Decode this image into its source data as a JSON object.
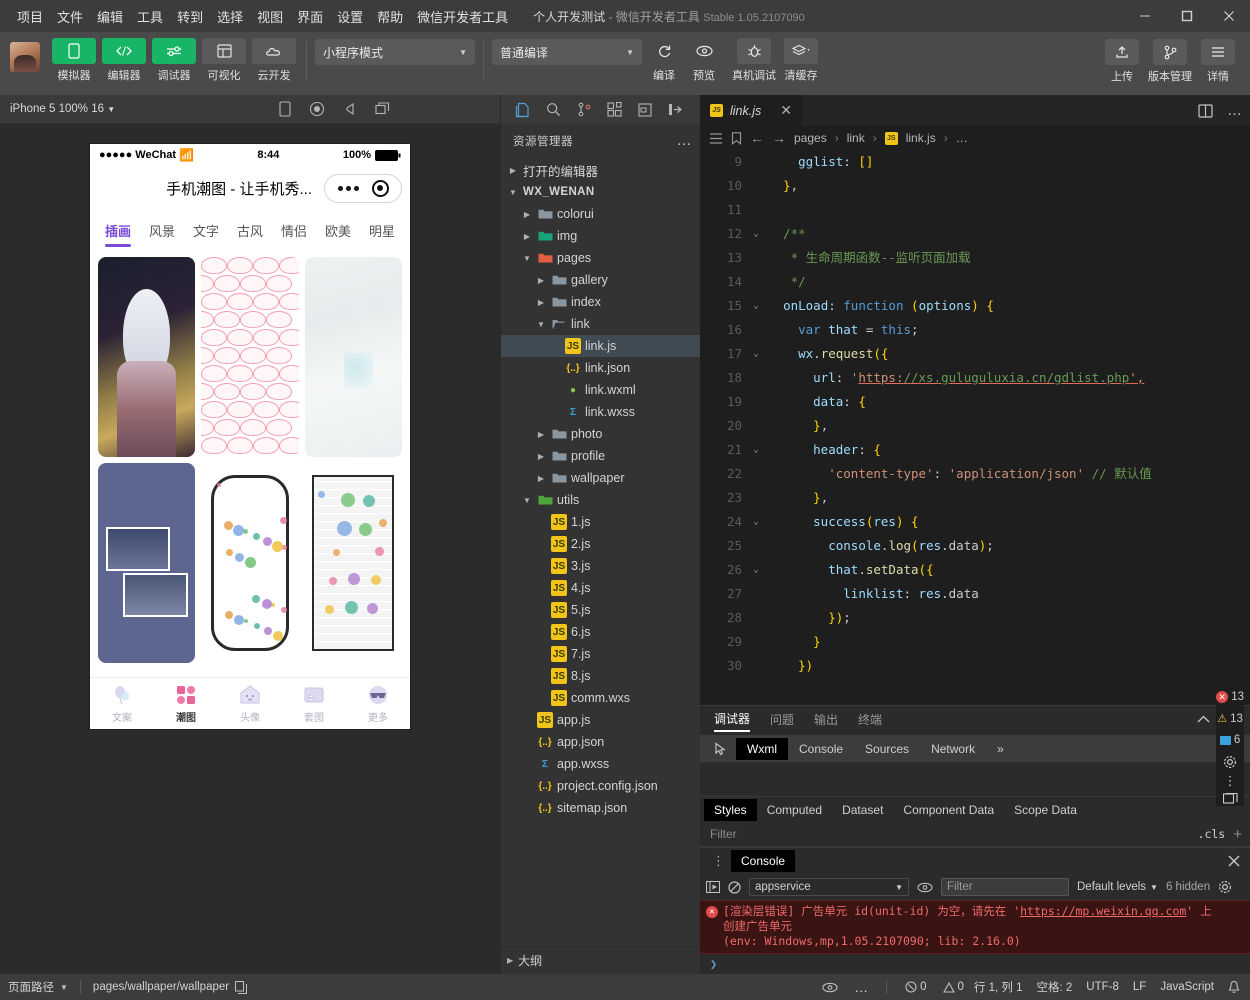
{
  "menu": {
    "items": [
      "项目",
      "文件",
      "编辑",
      "工具",
      "转到",
      "选择",
      "视图",
      "界面",
      "设置",
      "帮助",
      "微信开发者工具"
    ],
    "project_name": "个人开发测试",
    "dash": "-",
    "app_name": "微信开发者工具",
    "version": "Stable 1.05.2107090",
    "window": {
      "minimize": "–",
      "maximize": "▢",
      "close": "✕"
    }
  },
  "toolbar": {
    "buttons": [
      {
        "label": "模拟器",
        "icon": "phone-icon",
        "style": "green"
      },
      {
        "label": "编辑器",
        "icon": "code-icon",
        "style": "green"
      },
      {
        "label": "调试器",
        "icon": "sliders-icon",
        "style": "green"
      },
      {
        "label": "可视化",
        "icon": "layout-icon",
        "style": "grey"
      },
      {
        "label": "云开发",
        "icon": "cloud-icon",
        "style": "grey"
      }
    ],
    "mode_select": "小程序模式",
    "compile_select": "普通编译",
    "actions": [
      {
        "label": "编译",
        "icon": "refresh-icon"
      },
      {
        "label": "预览",
        "icon": "eye-icon"
      },
      {
        "label": "真机调试",
        "icon": "bug-icon"
      },
      {
        "label": "清缓存",
        "icon": "layers-icon"
      }
    ],
    "right_actions": [
      {
        "label": "上传",
        "icon": "upload-icon"
      },
      {
        "label": "版本管理",
        "icon": "branch-icon"
      },
      {
        "label": "详情",
        "icon": "menu-icon"
      }
    ]
  },
  "simulator": {
    "device": "iPhone 5 100% 16",
    "toolbar_icons": [
      "phone-rotate-icon",
      "record-icon",
      "volume-icon",
      "window-icon"
    ],
    "phone": {
      "carrier": "●●●●● WeChat",
      "wifi": "●",
      "time": "8:44",
      "battery_pct": "100%",
      "nav_title": "手机潮图 - 让手机秀...",
      "tabs": [
        "插画",
        "风景",
        "文字",
        "古风",
        "情侣",
        "欧美",
        "明星"
      ],
      "active_tab": "插画",
      "tabbar": [
        {
          "label": "文案",
          "icon": "balloon-icon",
          "active": false
        },
        {
          "label": "潮图",
          "icon": "grid-icon",
          "active": true
        },
        {
          "label": "头像",
          "icon": "house-icon",
          "active": false
        },
        {
          "label": "套图",
          "icon": "frame-icon",
          "active": false
        },
        {
          "label": "更多",
          "icon": "sunglasses-icon",
          "active": false
        }
      ]
    }
  },
  "activity_bar": {
    "icons": [
      "files-icon",
      "search-icon",
      "source-control-icon",
      "extensions-icon",
      "compile-icon",
      "collapse-icon"
    ],
    "active": "files-icon"
  },
  "explorer": {
    "title": "资源管理器",
    "more": "…",
    "open_editors": "打开的编辑器",
    "project": "WX_WENAN",
    "outline": "大纲",
    "tree": [
      {
        "name": "colorui",
        "depth": 1,
        "type": "folder",
        "arrow": "right"
      },
      {
        "name": "img",
        "depth": 1,
        "type": "folder-img",
        "arrow": "right"
      },
      {
        "name": "pages",
        "depth": 1,
        "type": "folder-pages",
        "arrow": "down"
      },
      {
        "name": "gallery",
        "depth": 2,
        "type": "folder",
        "arrow": "right"
      },
      {
        "name": "index",
        "depth": 2,
        "type": "folder",
        "arrow": "right"
      },
      {
        "name": "link",
        "depth": 2,
        "type": "folder-open",
        "arrow": "down"
      },
      {
        "name": "link.js",
        "depth": 3,
        "type": "js",
        "arrow": "",
        "selected": true
      },
      {
        "name": "link.json",
        "depth": 3,
        "type": "json",
        "arrow": ""
      },
      {
        "name": "link.wxml",
        "depth": 3,
        "type": "wxml",
        "arrow": ""
      },
      {
        "name": "link.wxss",
        "depth": 3,
        "type": "wxss",
        "arrow": ""
      },
      {
        "name": "photo",
        "depth": 2,
        "type": "folder",
        "arrow": "right"
      },
      {
        "name": "profile",
        "depth": 2,
        "type": "folder",
        "arrow": "right"
      },
      {
        "name": "wallpaper",
        "depth": 2,
        "type": "folder",
        "arrow": "right"
      },
      {
        "name": "utils",
        "depth": 1,
        "type": "folder-utils",
        "arrow": "down"
      },
      {
        "name": "1.js",
        "depth": 2,
        "type": "js",
        "arrow": ""
      },
      {
        "name": "2.js",
        "depth": 2,
        "type": "js",
        "arrow": ""
      },
      {
        "name": "3.js",
        "depth": 2,
        "type": "js",
        "arrow": ""
      },
      {
        "name": "4.js",
        "depth": 2,
        "type": "js",
        "arrow": ""
      },
      {
        "name": "5.js",
        "depth": 2,
        "type": "js",
        "arrow": ""
      },
      {
        "name": "6.js",
        "depth": 2,
        "type": "js",
        "arrow": ""
      },
      {
        "name": "7.js",
        "depth": 2,
        "type": "js",
        "arrow": ""
      },
      {
        "name": "8.js",
        "depth": 2,
        "type": "js",
        "arrow": ""
      },
      {
        "name": "comm.wxs",
        "depth": 2,
        "type": "js",
        "arrow": ""
      },
      {
        "name": "app.js",
        "depth": 1,
        "type": "js",
        "arrow": ""
      },
      {
        "name": "app.json",
        "depth": 1,
        "type": "json",
        "arrow": ""
      },
      {
        "name": "app.wxss",
        "depth": 1,
        "type": "wxss",
        "arrow": ""
      },
      {
        "name": "project.config.json",
        "depth": 1,
        "type": "json",
        "arrow": ""
      },
      {
        "name": "sitemap.json",
        "depth": 1,
        "type": "json",
        "arrow": ""
      }
    ]
  },
  "editor": {
    "tab": {
      "name": "link.js",
      "icon": "js-icon",
      "close": "✕"
    },
    "tab_right_icons": [
      "split-editor-icon",
      "more-icon"
    ],
    "breadcrumb_icons": [
      "outline-icon",
      "bookmark-icon",
      "back-icon",
      "forward-icon"
    ],
    "breadcrumb": [
      "pages",
      "link",
      "link.js",
      "…"
    ],
    "first_line": 9,
    "lines": [
      {
        "n": 9,
        "fold": "",
        "code": "    gglist: []"
      },
      {
        "n": 10,
        "fold": "",
        "code": "  },"
      },
      {
        "n": 11,
        "fold": "",
        "code": ""
      },
      {
        "n": 12,
        "fold": "down",
        "code": "  /**"
      },
      {
        "n": 13,
        "fold": "",
        "code": "   * 生命周期函数--监听页面加载"
      },
      {
        "n": 14,
        "fold": "",
        "code": "   */"
      },
      {
        "n": 15,
        "fold": "down",
        "code": "  onLoad: function (options) {"
      },
      {
        "n": 16,
        "fold": "",
        "code": "    var that = this;"
      },
      {
        "n": 17,
        "fold": "down",
        "code": "    wx.request({"
      },
      {
        "n": 18,
        "fold": "",
        "code": "      url: 'https://xs.guluguluxia.cn/gdlist.php',"
      },
      {
        "n": 19,
        "fold": "",
        "code": "      data: {"
      },
      {
        "n": 20,
        "fold": "",
        "code": "      },"
      },
      {
        "n": 21,
        "fold": "down",
        "code": "      header: {"
      },
      {
        "n": 22,
        "fold": "",
        "code": "        'content-type': 'application/json' // 默认值"
      },
      {
        "n": 23,
        "fold": "",
        "code": "      },"
      },
      {
        "n": 24,
        "fold": "down",
        "code": "      success(res) {"
      },
      {
        "n": 25,
        "fold": "",
        "code": "        console.log(res.data);"
      },
      {
        "n": 26,
        "fold": "down",
        "code": "        that.setData({"
      },
      {
        "n": 27,
        "fold": "",
        "code": "          linklist: res.data"
      },
      {
        "n": 28,
        "fold": "",
        "code": "        });"
      },
      {
        "n": 29,
        "fold": "",
        "code": "      }"
      },
      {
        "n": 30,
        "fold": "",
        "code": "    })"
      }
    ]
  },
  "debugger": {
    "panel_tabs": [
      "调试器",
      "问题",
      "输出",
      "终端"
    ],
    "panel_active": "调试器",
    "panel_right_icons": [
      "chevron-up-icon",
      "close-icon"
    ],
    "devtools_tabs": [
      "Wxml",
      "Console",
      "Sources",
      "Network"
    ],
    "devtools_active": "Wxml",
    "overflow": "»",
    "counts": {
      "errors": "13",
      "warnings": "13",
      "messages": "6"
    },
    "devtools_right_icons": [
      "gear-icon",
      "kebab-icon",
      "dock-icon"
    ],
    "style_tabs": [
      "Styles",
      "Computed",
      "Dataset",
      "Component Data",
      "Scope Data"
    ],
    "style_active": "Styles",
    "filter_placeholder": "Filter",
    "cls_label": ".cls",
    "cls_plus": "+"
  },
  "console": {
    "tab": "Console",
    "close": "✕",
    "context": "appservice",
    "filter_placeholder": "Filter",
    "levels": "Default levels",
    "hidden": "6 hidden",
    "message": {
      "part1": "[渲染层错误] 广告单元 id(unit-id) 为空，请先在 '",
      "link": "https://mp.weixin.qq.com",
      "part2": "' 上",
      "line2": "创建广告单元",
      "line3": "(env: Windows,mp,1.05.2107090; lib: 2.16.0)"
    },
    "prompt": "❯"
  },
  "statusbar": {
    "page_path_label": "页面路径",
    "page_path": "pages/wallpaper/wallpaper",
    "copy_icon": "copy-icon",
    "eye_icon": "eye-icon",
    "more_icon": "more-icon",
    "errors": "0",
    "warnings": "0",
    "position": "行 1, 列 1",
    "spaces": "空格: 2",
    "encoding": "UTF-8",
    "eol": "LF",
    "language": "JavaScript",
    "bell_icon": "bell-icon"
  },
  "colors": {
    "green": "#18b566",
    "accent_purple": "#7b4bd8",
    "error_red": "#e04b4b",
    "warn_yellow": "#e8c344",
    "editor_bg": "#1e1e1e",
    "panel_bg": "#2b2b2b",
    "sidebar_bg": "#333333"
  }
}
